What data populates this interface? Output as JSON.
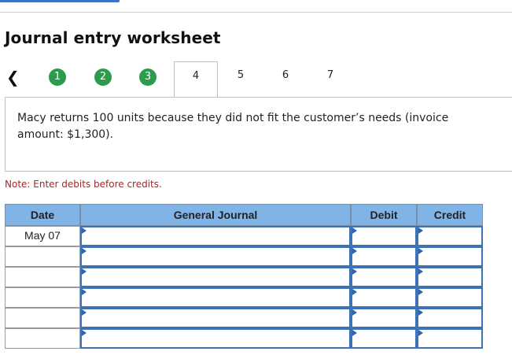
{
  "header": {
    "title": "Journal entry worksheet"
  },
  "steps": {
    "prev_icon": "chevron-left-icon",
    "items": [
      {
        "label": "1",
        "state": "done"
      },
      {
        "label": "2",
        "state": "done"
      },
      {
        "label": "3",
        "state": "done"
      },
      {
        "label": "4",
        "state": "active"
      },
      {
        "label": "5",
        "state": "pending"
      },
      {
        "label": "6",
        "state": "pending"
      },
      {
        "label": "7",
        "state": "pending"
      }
    ]
  },
  "panel": {
    "text": "Macy returns 100 units because they did not fit the customer’s needs (invoice amount: $1,300)."
  },
  "note": "Note: Enter debits before credits.",
  "journal": {
    "columns": [
      "Date",
      "General Journal",
      "Debit",
      "Credit"
    ],
    "rows": [
      {
        "date": "May 07",
        "account": "",
        "debit": "",
        "credit": ""
      },
      {
        "date": "",
        "account": "",
        "debit": "",
        "credit": ""
      },
      {
        "date": "",
        "account": "",
        "debit": "",
        "credit": ""
      },
      {
        "date": "",
        "account": "",
        "debit": "",
        "credit": ""
      },
      {
        "date": "",
        "account": "",
        "debit": "",
        "credit": ""
      },
      {
        "date": "",
        "account": "",
        "debit": "",
        "credit": ""
      }
    ]
  },
  "colors": {
    "step_done": "#2d9b4c",
    "header_bg": "#80b3e6",
    "input_border": "#3d73b5",
    "note": "#b42020"
  }
}
